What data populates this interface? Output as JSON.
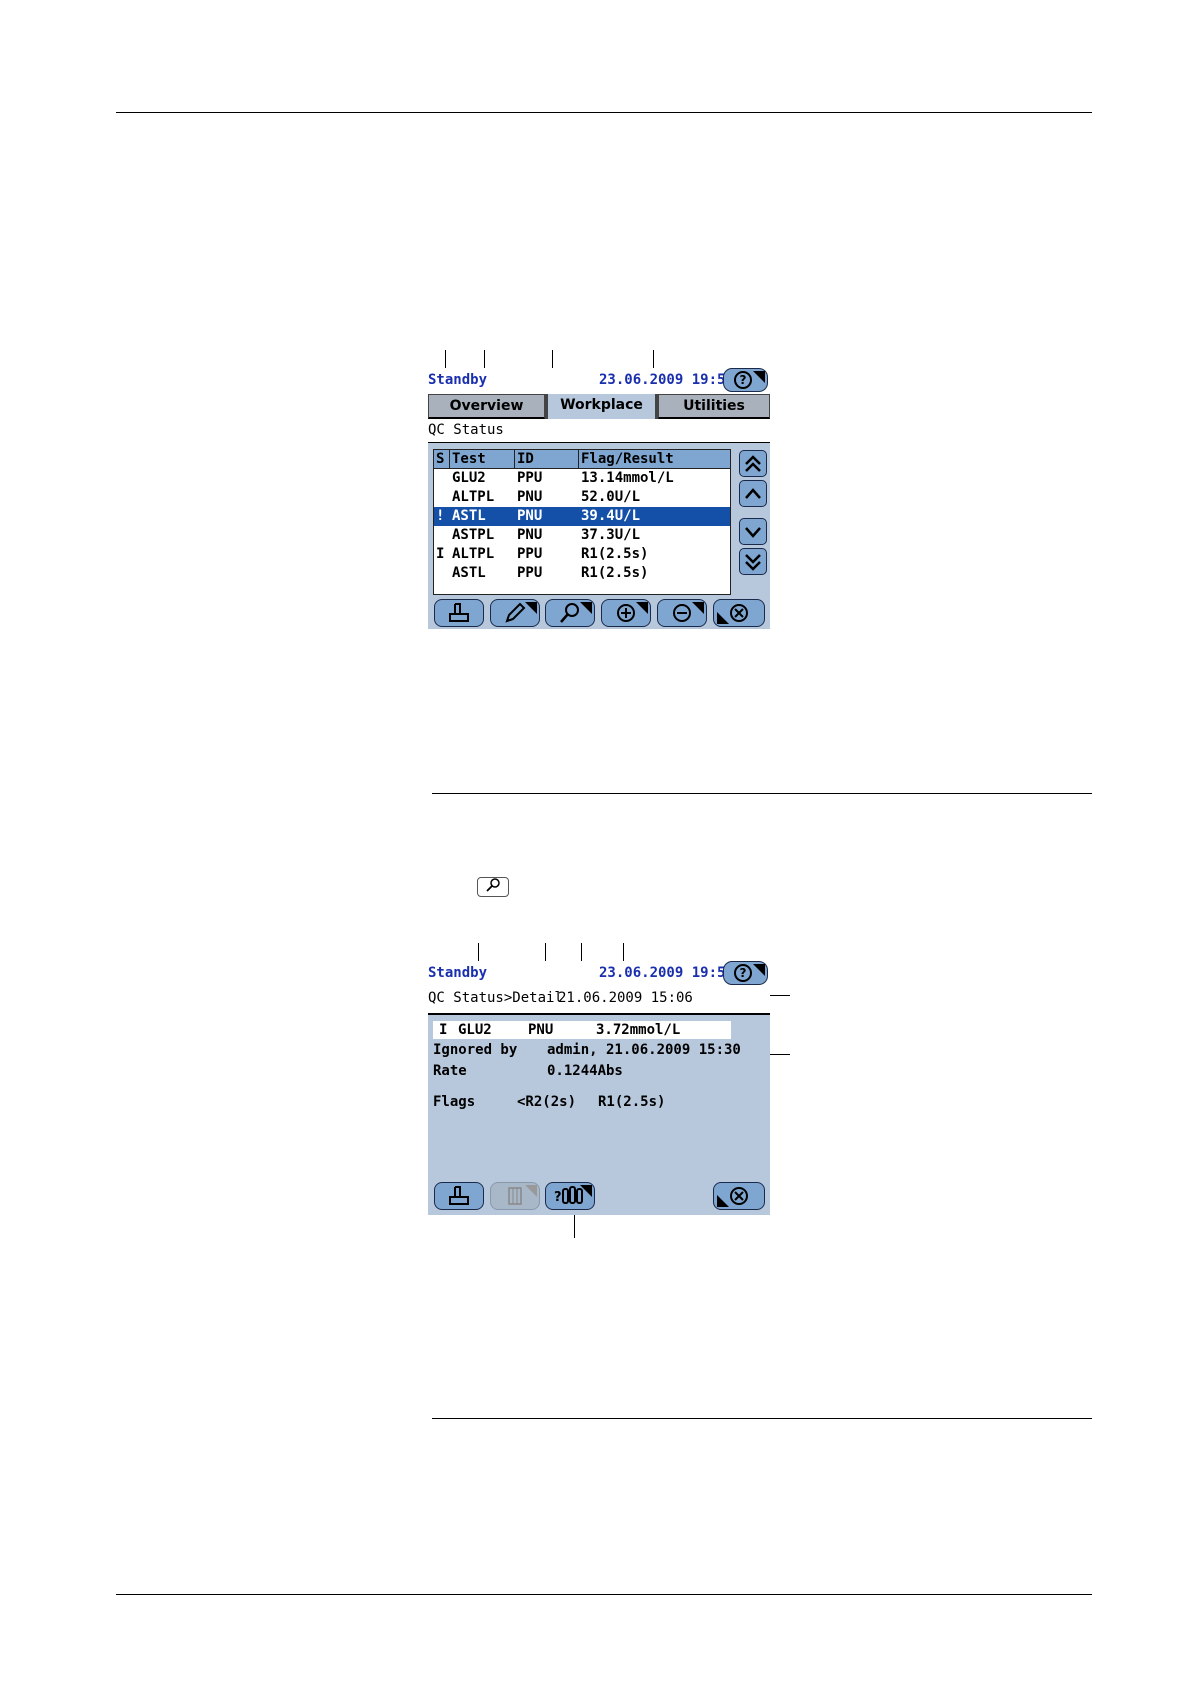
{
  "screen1": {
    "status": "Standby",
    "datetime": "23.06.2009 19:50",
    "tabs": [
      "Overview",
      "Workplace",
      "Utilities"
    ],
    "page_title": "QC Status",
    "columns": [
      "S",
      "Test",
      "ID",
      "Flag/Result"
    ],
    "rows": [
      {
        "s": "",
        "test": "GLU2",
        "id": "PPU",
        "result": "13.14mmol/L"
      },
      {
        "s": "",
        "test": "ALTPL",
        "id": "PNU",
        "result": "52.0U/L"
      },
      {
        "s": "!",
        "test": "ASTL",
        "id": "PNU",
        "result": "39.4U/L"
      },
      {
        "s": "",
        "test": "ASTPL",
        "id": "PNU",
        "result": "37.3U/L"
      },
      {
        "s": "I",
        "test": "ALTPL",
        "id": "PPU",
        "result": "R1(2.5s)"
      },
      {
        "s": "",
        "test": "ASTL",
        "id": "PPU",
        "result": "R1(2.5s)"
      }
    ],
    "toolbar_icons": [
      "print-icon",
      "edit-icon",
      "search-icon",
      "add-icon",
      "remove-icon",
      "close-icon"
    ],
    "nav_icons": [
      "page-up-icon",
      "up-icon",
      "down-icon",
      "page-down-icon"
    ]
  },
  "screen2": {
    "status": "Standby",
    "datetime": "23.06.2009 19:52",
    "page_title": "QC Status>Detail",
    "detail_timestamp": "21.06.2009 15:06",
    "selected": {
      "s": "I",
      "test": "GLU2",
      "id": "PNU",
      "result": "3.72mmol/L"
    },
    "ignored_by_label": "Ignored by",
    "ignored_by_value": "admin, 21.06.2009 15:30",
    "rate_label": "Rate",
    "rate_value": "0.1244Abs",
    "flags_label": "Flags",
    "flag1": "<R2(2s)",
    "flag2": "R1(2.5s)"
  },
  "colors": {
    "status_blue": "#1a2fae",
    "button_blue": "#7fa6d0",
    "selection_blue": "#1550a8",
    "panel_bg": "#b8c8dc"
  }
}
